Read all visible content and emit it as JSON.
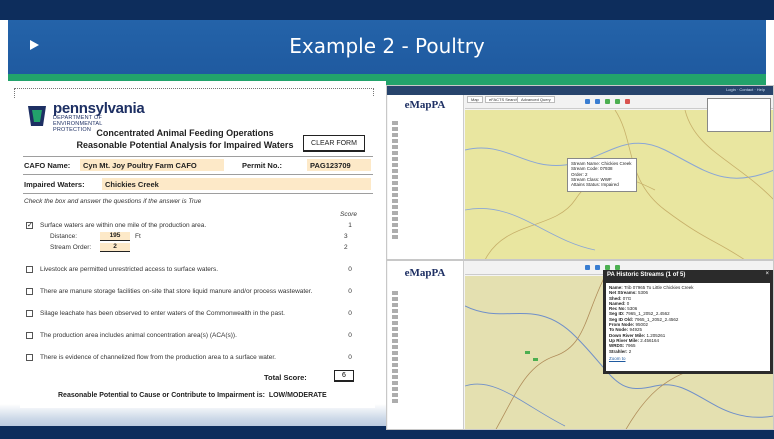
{
  "slide": {
    "title": "Example 2 - Poultry"
  },
  "form": {
    "agency": {
      "name": "pennsylvania",
      "dept_line1": "DEPARTMENT OF ENVIRONMENTAL",
      "dept_line2": "PROTECTION"
    },
    "title_line1": "Concentrated Animal Feeding Operations",
    "title_line2": "Reasonable Potential Analysis for Impaired Waters",
    "clear_button": "CLEAR FORM",
    "cafo_name_label": "CAFO Name:",
    "cafo_name_value": "Cyn Mt. Joy Poultry Farm CAFO",
    "permit_label": "Permit No.:",
    "permit_value": "PAG123709",
    "impaired_label": "Impaired Waters:",
    "impaired_value": "Chickies Creek",
    "instructions": "Check the box and answer the questions if the answer is True",
    "score_header": "Score",
    "q1": {
      "checked": true,
      "mark": "✓",
      "text": "Surface waters are within one mile of the production area.",
      "score": "1"
    },
    "distance_label": "Distance:",
    "distance_value": "195",
    "distance_unit": "Ft",
    "distance_score": "3",
    "stream_order_label": "Stream Order:",
    "stream_order_value": "2",
    "stream_order_score": "2",
    "q2": {
      "checked": false,
      "text": "Livestock are permitted unrestricted access to surface waters.",
      "score": "0"
    },
    "q3": {
      "checked": false,
      "text": "There are manure storage facilities on-site that store liquid manure and/or process wastewater.",
      "score": "0"
    },
    "q4": {
      "checked": false,
      "text": "Silage leachate has been observed to enter waters of the Commonwealth in the past.",
      "score": "0"
    },
    "q5": {
      "checked": false,
      "text": "The production area includes animal concentration area(s) (ACA(s)).",
      "score": "0"
    },
    "q6": {
      "checked": false,
      "text": "There is evidence of channelized flow from the production area to a surface water.",
      "score": "0"
    },
    "total_label": "Total Score:",
    "total_value": "6",
    "rp_label": "Reasonable Potential to Cause or Contribute to Impairment is:",
    "rp_value": "LOW/MODERATE"
  },
  "emap_top": {
    "app_name": "eMapPA",
    "tabs": [
      "Map",
      "eFACTS Search",
      "Advanced Query"
    ],
    "popup_lines": [
      "Stream Name: Chickies Creek",
      "Stream Code: 07938",
      "Order: 2",
      "Stream Class: WWF",
      "Attains Status: Impaired"
    ]
  },
  "emap_bottom": {
    "app_name": "eMapPA",
    "popup_title": "PA Historic Streams (1 of 5)",
    "attributes": [
      {
        "k": "Name:",
        "v": "Trib 07965 To Little Chickies Creek"
      },
      {
        "k": "Net Streams:",
        "v": "5306"
      },
      {
        "k": "Shed:",
        "v": "07G"
      },
      {
        "k": "Named:",
        "v": "0"
      },
      {
        "k": "Rec No:",
        "v": "5306"
      },
      {
        "k": "Seg ID:",
        "v": "7965_1_2052_2.4562"
      },
      {
        "k": "Seg ID Old:",
        "v": "7965_1_2052_2.4562"
      },
      {
        "k": "From Node:",
        "v": "95002"
      },
      {
        "k": "To Node:",
        "v": "94925"
      },
      {
        "k": "Down River Mile:",
        "v": "1.205261"
      },
      {
        "k": "Up River Mile:",
        "v": "2.456164"
      },
      {
        "k": "WRDS:",
        "v": "7965"
      },
      {
        "k": "Strahler:",
        "v": "2"
      }
    ],
    "zoom_link": "Zoom to"
  },
  "colors": {
    "title_blue": "#2463a9",
    "accent_green": "#22a36b",
    "field_fill": "#fde9c8",
    "map_fill": "#e9e6a0"
  }
}
